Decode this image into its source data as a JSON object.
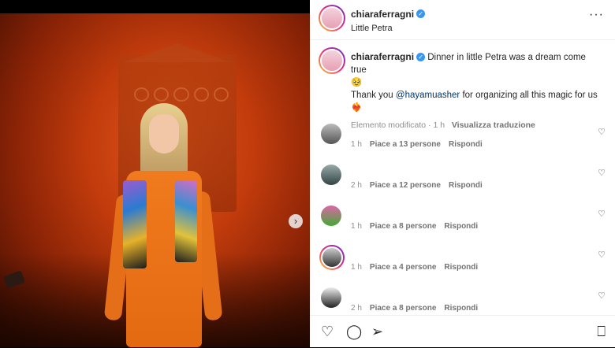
{
  "post": {
    "username": "chiaraferragni",
    "location": "Little Petra",
    "more_icon": "more-horizontal-icon",
    "verified_icon": "verified-badge-icon"
  },
  "caption": {
    "username": "chiaraferragni",
    "text_1": "Dinner in little Petra was a dream come true",
    "emoji_1": "🥹",
    "text_2_prefix": "Thank you",
    "mention": "@hayamuasher",
    "text_2_suffix": "for organizing all this magic for us",
    "emoji_2": "❤️‍🔥",
    "edited": "Elemento modificato",
    "time": "1 h",
    "translate": "Visualizza traduzione"
  },
  "comments": [
    {
      "time": "1 h",
      "likes": "Piace a 13 persone",
      "reply": "Rispondi"
    },
    {
      "time": "2 h",
      "likes": "Piace a 12 persone",
      "reply": "Rispondi"
    },
    {
      "time": "1 h",
      "likes": "Piace a 8 persone",
      "reply": "Rispondi"
    },
    {
      "time": "1 h",
      "likes": "Piace a 4 persone",
      "reply": "Rispondi"
    },
    {
      "time": "2 h",
      "likes": "Piace a 8 persone",
      "reply": "Rispondi"
    }
  ],
  "icons": {
    "like": "heart-icon",
    "comment": "comment-icon",
    "share": "share-icon",
    "save": "bookmark-icon",
    "next": "chevron-right-icon"
  }
}
